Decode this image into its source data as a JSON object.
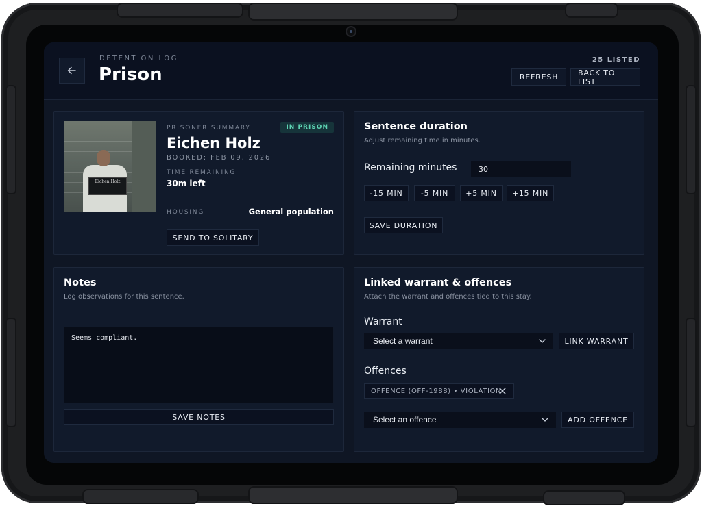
{
  "header": {
    "eyebrow": "DETENTION LOG",
    "title": "Prison",
    "listed_count": "25 LISTED",
    "refresh_label": "REFRESH",
    "back_to_list_label": "BACK TO LIST",
    "back_icon": "arrow-left-icon"
  },
  "summary": {
    "section_label": "PRISONER SUMMARY",
    "status": "IN PRISON",
    "status_color": "#5ed3b3",
    "name": "Eichen Holz",
    "booked": "BOOKED: FEB 09, 2026",
    "time_label": "TIME REMAINING",
    "time_value": "30m left",
    "housing_label": "HOUSING",
    "housing_value": "General population",
    "solitary_label": "SEND TO SOLITARY",
    "placard_text": "Eichen Holz"
  },
  "sentence": {
    "title": "Sentence duration",
    "subtitle": "Adjust remaining time in minutes.",
    "field_label": "Remaining minutes",
    "minutes_value": "30",
    "adjust_buttons": [
      "-15 MIN",
      "-5 MIN",
      "+5 MIN",
      "+15 MIN"
    ],
    "save_label": "SAVE DURATION"
  },
  "notes": {
    "title": "Notes",
    "subtitle": "Log observations for this sentence.",
    "content": "Seems compliant.",
    "save_label": "SAVE NOTES"
  },
  "warrant": {
    "title": "Linked warrant & offences",
    "subtitle": "Attach the warrant and offences tied to this stay.",
    "warrant_label": "Warrant",
    "warrant_select": "Select a warrant",
    "link_label": "LINK WARRANT",
    "offences_label": "Offences",
    "offence_tag": "OFFENCE (OFF-1988) • VIOLATION",
    "offence_select": "Select an offence",
    "add_label": "ADD OFFENCE"
  },
  "theme": {
    "background": "#0f1624",
    "card": "#111a2b",
    "accent": "#5ed3b3"
  }
}
